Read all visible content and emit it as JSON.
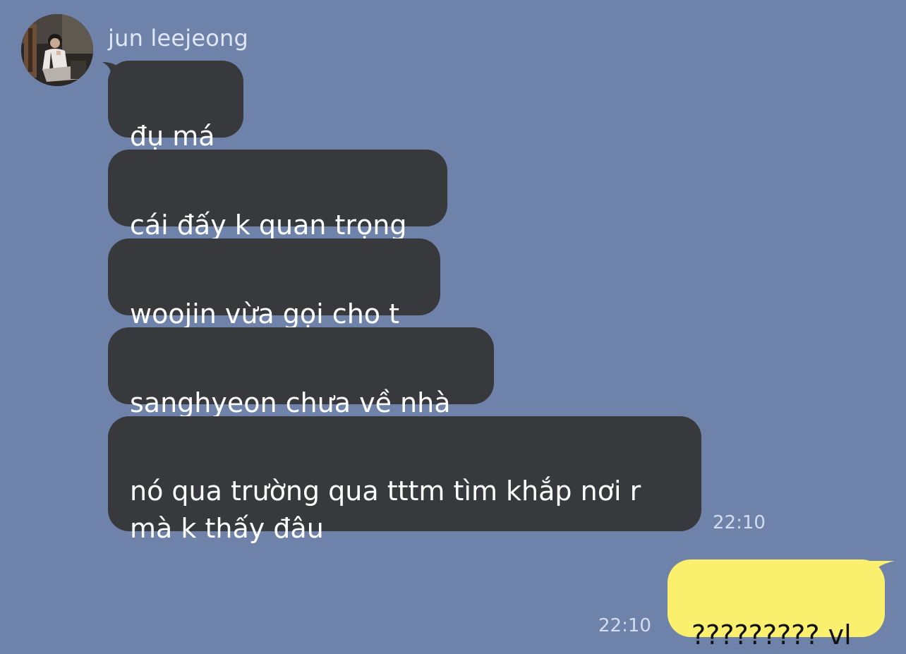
{
  "contact": {
    "name": "jun leejeong",
    "avatar_icon": "profile-photo"
  },
  "messages": [
    {
      "direction": "incoming",
      "text": "đụ má"
    },
    {
      "direction": "incoming",
      "text": "cái đấy k quan trọng"
    },
    {
      "direction": "incoming",
      "text": "woojin vừa gọi cho t"
    },
    {
      "direction": "incoming",
      "text": "sanghyeon chưa về nhà"
    },
    {
      "direction": "incoming",
      "text": "nó qua trường qua tttm tìm khắp nơi r\nmà k thấy đâu",
      "time": "22:10"
    },
    {
      "direction": "outgoing",
      "text": "????????? vl",
      "time": "22:10"
    }
  ],
  "colors": {
    "background": "#6f83aa",
    "incoming_bubble": "#38393d",
    "outgoing_bubble": "#fbef6e",
    "incoming_text": "#ffffff",
    "outgoing_text": "#111111"
  }
}
